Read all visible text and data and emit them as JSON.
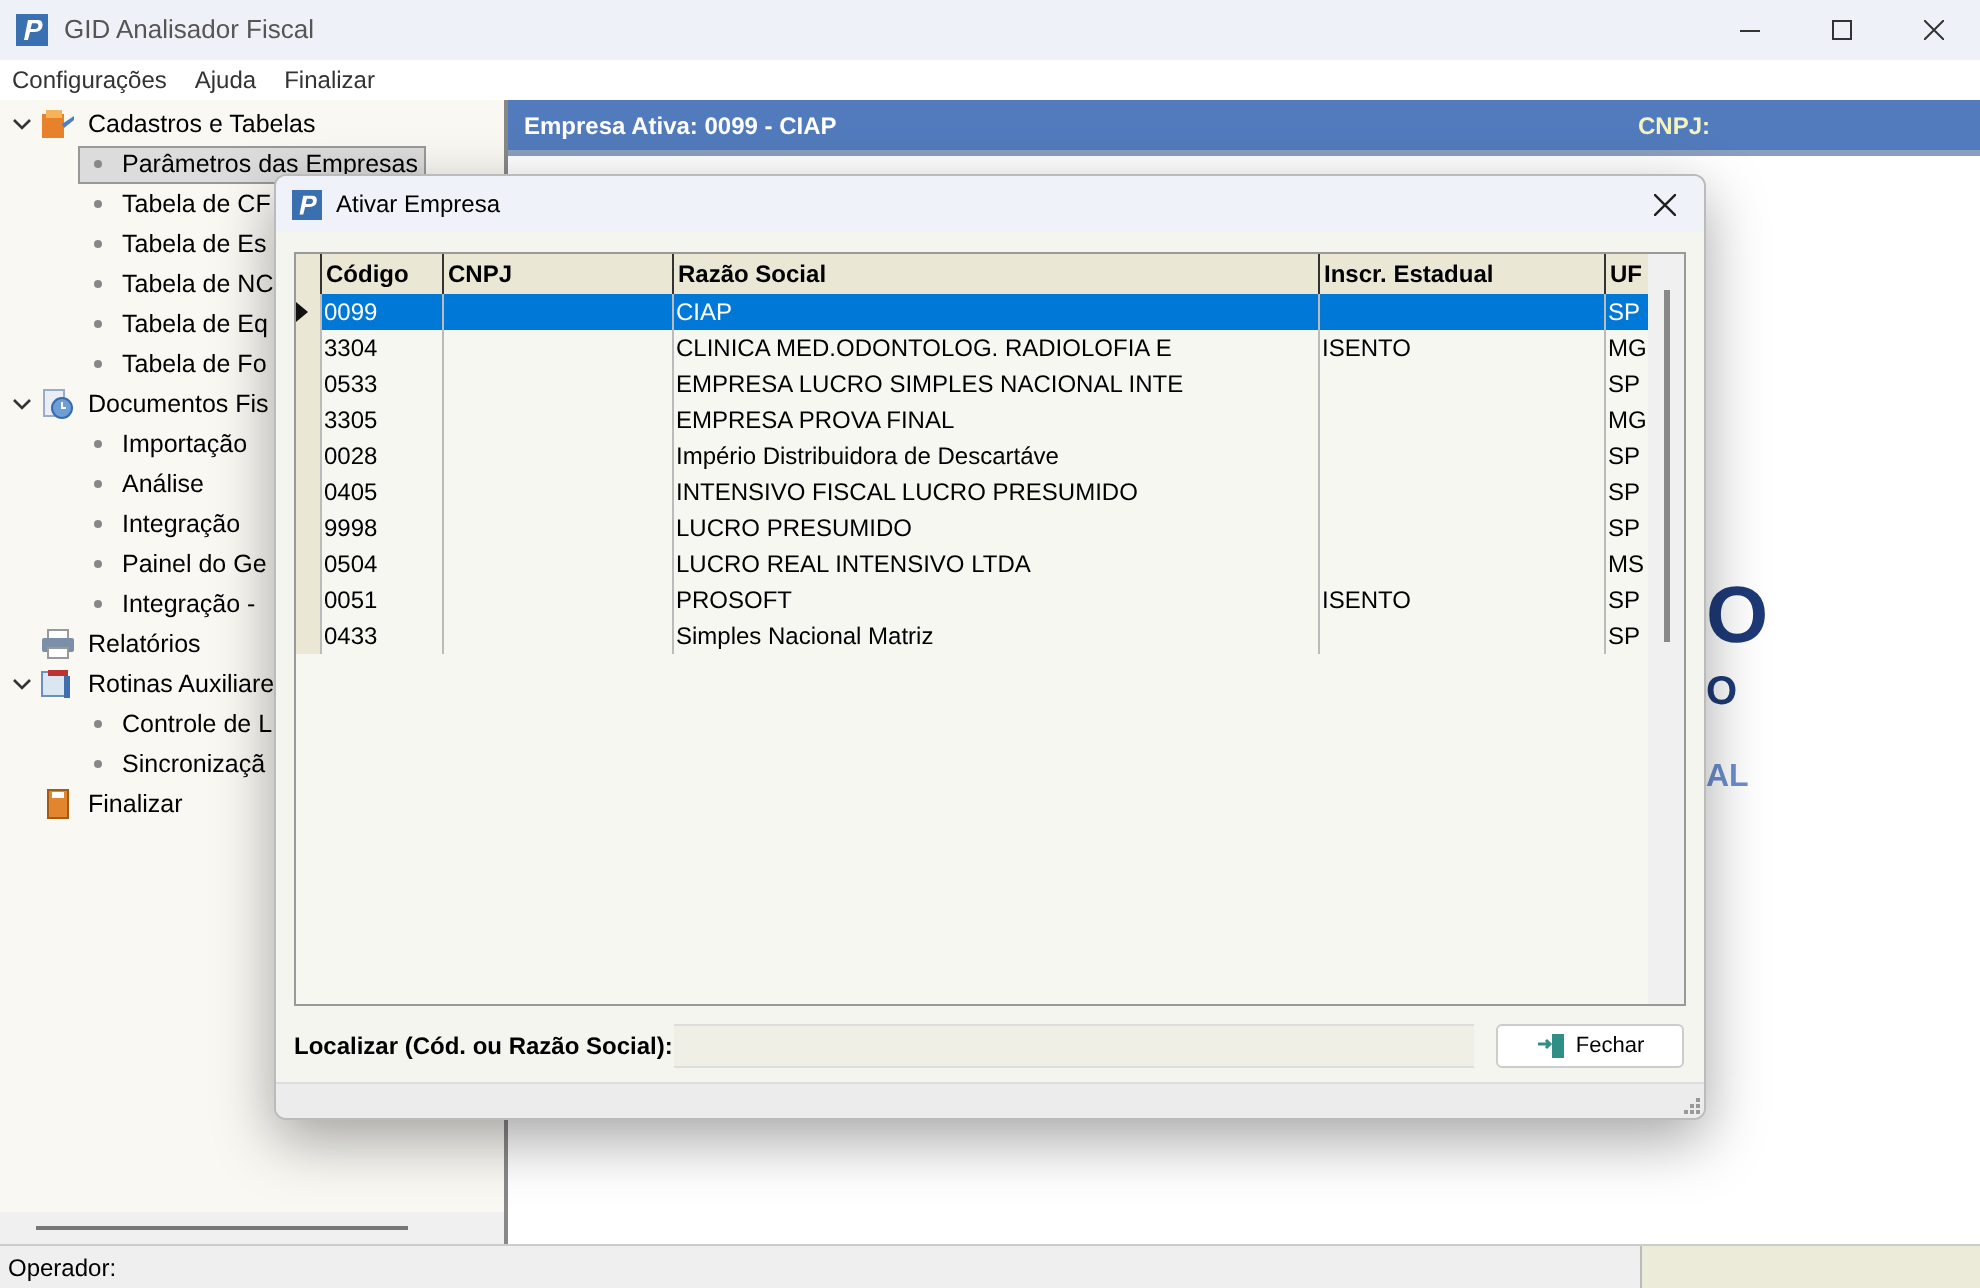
{
  "window": {
    "title": "GID Analisador Fiscal"
  },
  "menu": [
    "Configurações",
    "Ajuda",
    "Finalizar"
  ],
  "tree": [
    {
      "label": "Cadastros e Tabelas",
      "kind": "folder",
      "expanded": true,
      "children": [
        {
          "label": "Parâmetros das Empresas",
          "selected": true
        },
        {
          "label": "Tabela de CF",
          "selected": false
        },
        {
          "label": "Tabela de Es",
          "selected": false
        },
        {
          "label": "Tabela de NC",
          "selected": false
        },
        {
          "label": "Tabela de Eq",
          "selected": false
        },
        {
          "label": "Tabela de Fo",
          "selected": false
        }
      ]
    },
    {
      "label": "Documentos Fis",
      "kind": "clock",
      "expanded": true,
      "children": [
        {
          "label": "Importação",
          "selected": false
        },
        {
          "label": "Análise",
          "selected": false
        },
        {
          "label": "Integração",
          "selected": false
        },
        {
          "label": "Painel do Ge",
          "selected": false
        },
        {
          "label": "Integração -",
          "selected": false
        }
      ]
    },
    {
      "label": "Relatórios",
      "kind": "printer"
    },
    {
      "label": "Rotinas Auxiliare",
      "kind": "tools",
      "expanded": true,
      "children": [
        {
          "label": "Controle de L",
          "selected": false
        },
        {
          "label": "Sincronizaçã",
          "selected": false
        }
      ]
    },
    {
      "label": "Finalizar",
      "kind": "exit"
    }
  ],
  "header": {
    "company": "Empresa Ativa: 0099 - CIAP",
    "cnpj_label": "CNPJ:"
  },
  "logo_fragments": [
    "O",
    "O",
    "AL"
  ],
  "status_bar": {
    "operator_label": "Operador:"
  },
  "dialog": {
    "title": "Ativar Empresa",
    "columns": [
      "Código",
      "CNPJ",
      "Razão Social",
      "Inscr. Estadual",
      "UF"
    ],
    "rows": [
      {
        "cells": [
          "0099",
          "",
          "CIAP",
          "",
          "SP"
        ],
        "selected": true
      },
      {
        "cells": [
          "3304",
          "",
          "CLINICA MED.ODONTOLOG. RADIOLOFIA E",
          "ISENTO",
          "MG"
        ],
        "selected": false
      },
      {
        "cells": [
          "0533",
          "",
          "EMPRESA LUCRO SIMPLES NACIONAL INTE",
          "",
          "SP"
        ],
        "selected": false
      },
      {
        "cells": [
          "3305",
          "",
          "EMPRESA PROVA FINAL",
          "",
          "MG"
        ],
        "selected": false
      },
      {
        "cells": [
          "0028",
          "",
          "Império Distribuidora de Descartáve",
          "",
          "SP"
        ],
        "selected": false
      },
      {
        "cells": [
          "0405",
          "",
          "INTENSIVO FISCAL LUCRO PRESUMIDO",
          "",
          "SP"
        ],
        "selected": false
      },
      {
        "cells": [
          "9998",
          "",
          "LUCRO PRESUMIDO",
          "",
          "SP"
        ],
        "selected": false
      },
      {
        "cells": [
          "0504",
          "",
          "LUCRO REAL INTENSIVO LTDA",
          "",
          "MS"
        ],
        "selected": false
      },
      {
        "cells": [
          "0051",
          "",
          "PROSOFT",
          "ISENTO",
          "SP"
        ],
        "selected": false
      },
      {
        "cells": [
          "0433",
          "",
          "Simples Nacional Matriz",
          "",
          "SP"
        ],
        "selected": false
      }
    ],
    "search_label": "Localizar (Cód. ou Razão Social):",
    "close_button": "Fechar"
  }
}
